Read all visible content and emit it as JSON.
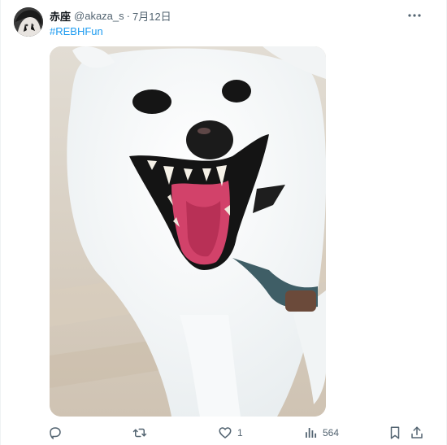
{
  "author": {
    "name": "赤座",
    "handle": "@akaza_s",
    "separator": "·",
    "date": "7月12日"
  },
  "post": {
    "hashtag": "#REBHFun"
  },
  "actions": {
    "reply_count": "",
    "repost_count": "",
    "like_count": "1",
    "views_count": "564"
  },
  "icons": {
    "more": "more-horizontal-icon",
    "reply": "reply-icon",
    "repost": "repost-icon",
    "like": "heart-icon",
    "views": "views-bar-chart-icon",
    "bookmark": "bookmark-icon",
    "share": "share-icon"
  },
  "colors": {
    "accent": "#1d9bf0",
    "muted_text": "#536471",
    "primary_text": "#0f1419"
  }
}
